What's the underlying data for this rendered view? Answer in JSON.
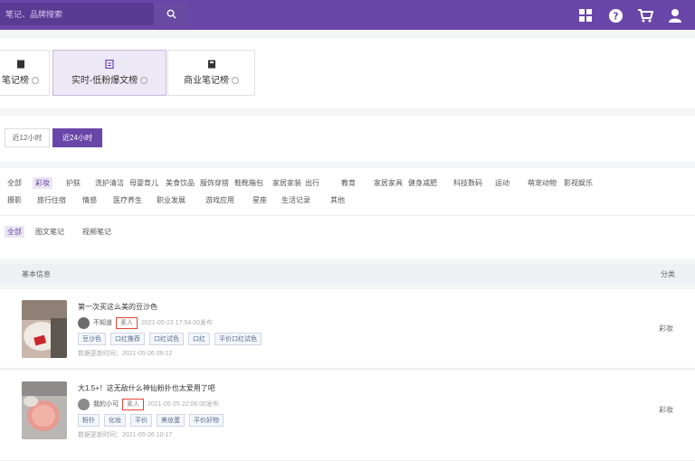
{
  "search": {
    "placeholder": "笔记、品牌搜索"
  },
  "cards": [
    {
      "label": "笔记榜",
      "active": false
    },
    {
      "label": "实时-低粉爆文榜",
      "active": true
    },
    {
      "label": "商业笔记榜",
      "active": false
    }
  ],
  "time_filters": [
    {
      "label": "近12小时",
      "active": false
    },
    {
      "label": "近24小时",
      "active": true
    }
  ],
  "categories_row1": [
    "全部",
    "彩妆",
    "护肤",
    "洗护清洁",
    "母婴育儿",
    "美食饮品",
    "服饰穿搭",
    "鞋靴箱包",
    "家居家装",
    "出行",
    "教育",
    "家居家具",
    "健身减肥",
    "科技数码",
    "运动",
    "萌宠动物",
    "影视娱乐"
  ],
  "categories_row2": [
    "摄影",
    "旅行住宿",
    "情感",
    "医疗养生",
    "职业发展",
    "游戏应用",
    "星座",
    "生活记录",
    "其他"
  ],
  "selected_category": "彩妆",
  "note_types": [
    "全部",
    "图文笔记",
    "视频笔记"
  ],
  "selected_note_type": "全部",
  "table": {
    "col_basic": "基本信息",
    "col_right": "分类",
    "rows": [
      {
        "title": "第一次买这么美的豆沙色",
        "author": "不知道",
        "badge": "素人",
        "pub_time": "2021-05-23 17:54:00发布",
        "tags": [
          "豆沙色",
          "口红推荐",
          "口红试色",
          "口红",
          "平价口红试色"
        ],
        "update_time": "数据更新时间：2021-05-26 09:12",
        "category": "彩妆"
      },
      {
        "title": "大1.5+！这无敌什么神仙粉扑也太爱用了吧",
        "author": "我的小可",
        "badge": "素人",
        "pub_time": "2021-05-25 22:06:00发布",
        "tags": [
          "粉扑",
          "化妆",
          "平价",
          "美妆蛋",
          "平价好物"
        ],
        "update_time": "数据更新时间：2021-05-26 10:17",
        "category": "彩妆"
      }
    ]
  },
  "colors": {
    "accent": "#6a46a8",
    "badge_border": "#e0453a"
  }
}
